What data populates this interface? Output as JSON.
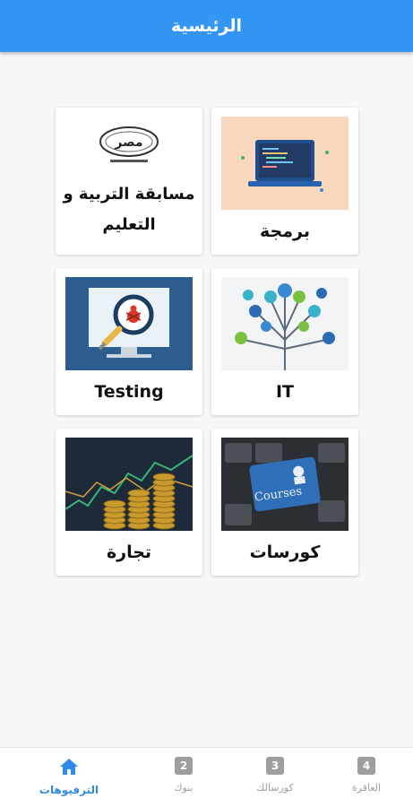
{
  "appbar": {
    "title": "الرئيسية"
  },
  "cards": {
    "contest": {
      "label": "مسابقة التربية و التعليم",
      "logo_text": "مصر"
    },
    "programming": {
      "label": "برمجة"
    },
    "testing": {
      "label": "Testing"
    },
    "it": {
      "label": "IT"
    },
    "trade": {
      "label": "تجارة"
    },
    "courses": {
      "label": "كورسات",
      "key_text": "Courses"
    }
  },
  "nav": {
    "items": [
      {
        "label": "الترفيوهات",
        "icon": "home-icon",
        "active": true
      },
      {
        "label": "بنوك",
        "badge": "2"
      },
      {
        "label": "كورسالك",
        "badge": "3"
      },
      {
        "label": "العاقرة",
        "badge": "4"
      }
    ]
  },
  "colors": {
    "primary": "#3396f3",
    "active_nav": "#2f8ae8",
    "inactive_nav": "#9e9e9e"
  }
}
